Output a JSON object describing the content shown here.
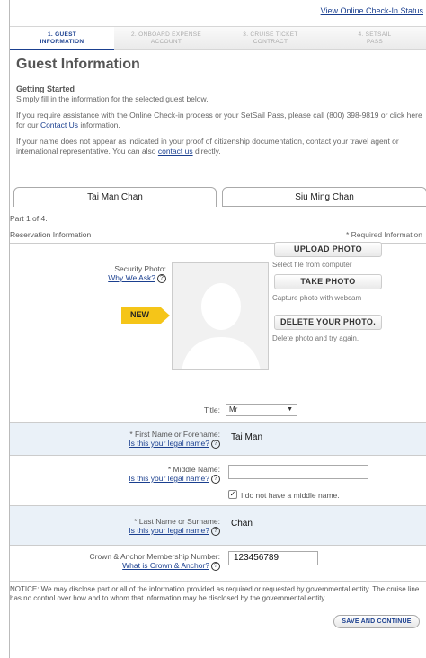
{
  "header": {
    "status_link": "View Online Check-In Status"
  },
  "steps": [
    {
      "line1": "1. GUEST",
      "line2": "INFORMATION"
    },
    {
      "line1": "2. ONBOARD EXPENSE",
      "line2": "ACCOUNT"
    },
    {
      "line1": "3. CRUISE TICKET",
      "line2": "CONTRACT"
    },
    {
      "line1": "4. SETSAIL",
      "line2": "PASS"
    }
  ],
  "page": {
    "title": "Guest Information",
    "getting_started": "Getting Started",
    "instructions": "Simply fill in the information for the selected guest below.",
    "assist_before": "If you require assistance with the Online Check-in process or your SetSail Pass, please call (800) 398-9819 or click here for our ",
    "assist_link": "Contact Us",
    "assist_after": " information.",
    "name_before": "If your name does not appear as indicated in your proof of citizenship documentation, contact your travel agent or international representative. You can also ",
    "name_link": "contact us",
    "name_after": " directly."
  },
  "tabs": [
    {
      "label": "Tai Man Chan"
    },
    {
      "label": "Siu Ming Chan"
    }
  ],
  "section": {
    "part": "Part 1 of 4.",
    "title": "Reservation Information",
    "required": "* Required Information"
  },
  "photo": {
    "label": "Security Photo:",
    "why_link": "Why We Ask?",
    "new_badge": "NEW",
    "upload_label": "UPLOAD PHOTO",
    "upload_hint": "Select file from computer",
    "take_label": "TAKE PHOTO",
    "take_hint": "Capture photo with webcam",
    "delete_label": "DELETE YOUR PHOTO.",
    "delete_hint": "Delete photo and try again."
  },
  "form": {
    "title_label": "Title:",
    "title_value": "Mr",
    "first_label": "* First Name or Forename:",
    "first_link": "Is this your legal name?",
    "first_value": "Tai Man",
    "middle_label": "* Middle Name:",
    "middle_link": "Is this your legal name?",
    "middle_value": "",
    "no_middle_label": "I do not have a middle name.",
    "no_middle_checked": "✓",
    "last_label": "* Last Name or Surname:",
    "last_link": "Is this your legal name?",
    "last_value": "Chan",
    "crown_label": "Crown & Anchor Membership Number:",
    "crown_link": "What is Crown & Anchor?",
    "crown_value": "123456789"
  },
  "notice": "NOTICE:  We may disclose part or all of the information provided as required or requested by governmental entity. The cruise line has no control over how and to whom that information may be disclosed by the governmental entity.",
  "actions": {
    "save_label": "SAVE AND CONTINUE"
  },
  "colors": {
    "link": "#1a3f8f",
    "new_badge": "#f5c518",
    "row_shade": "#eaf1f8"
  }
}
